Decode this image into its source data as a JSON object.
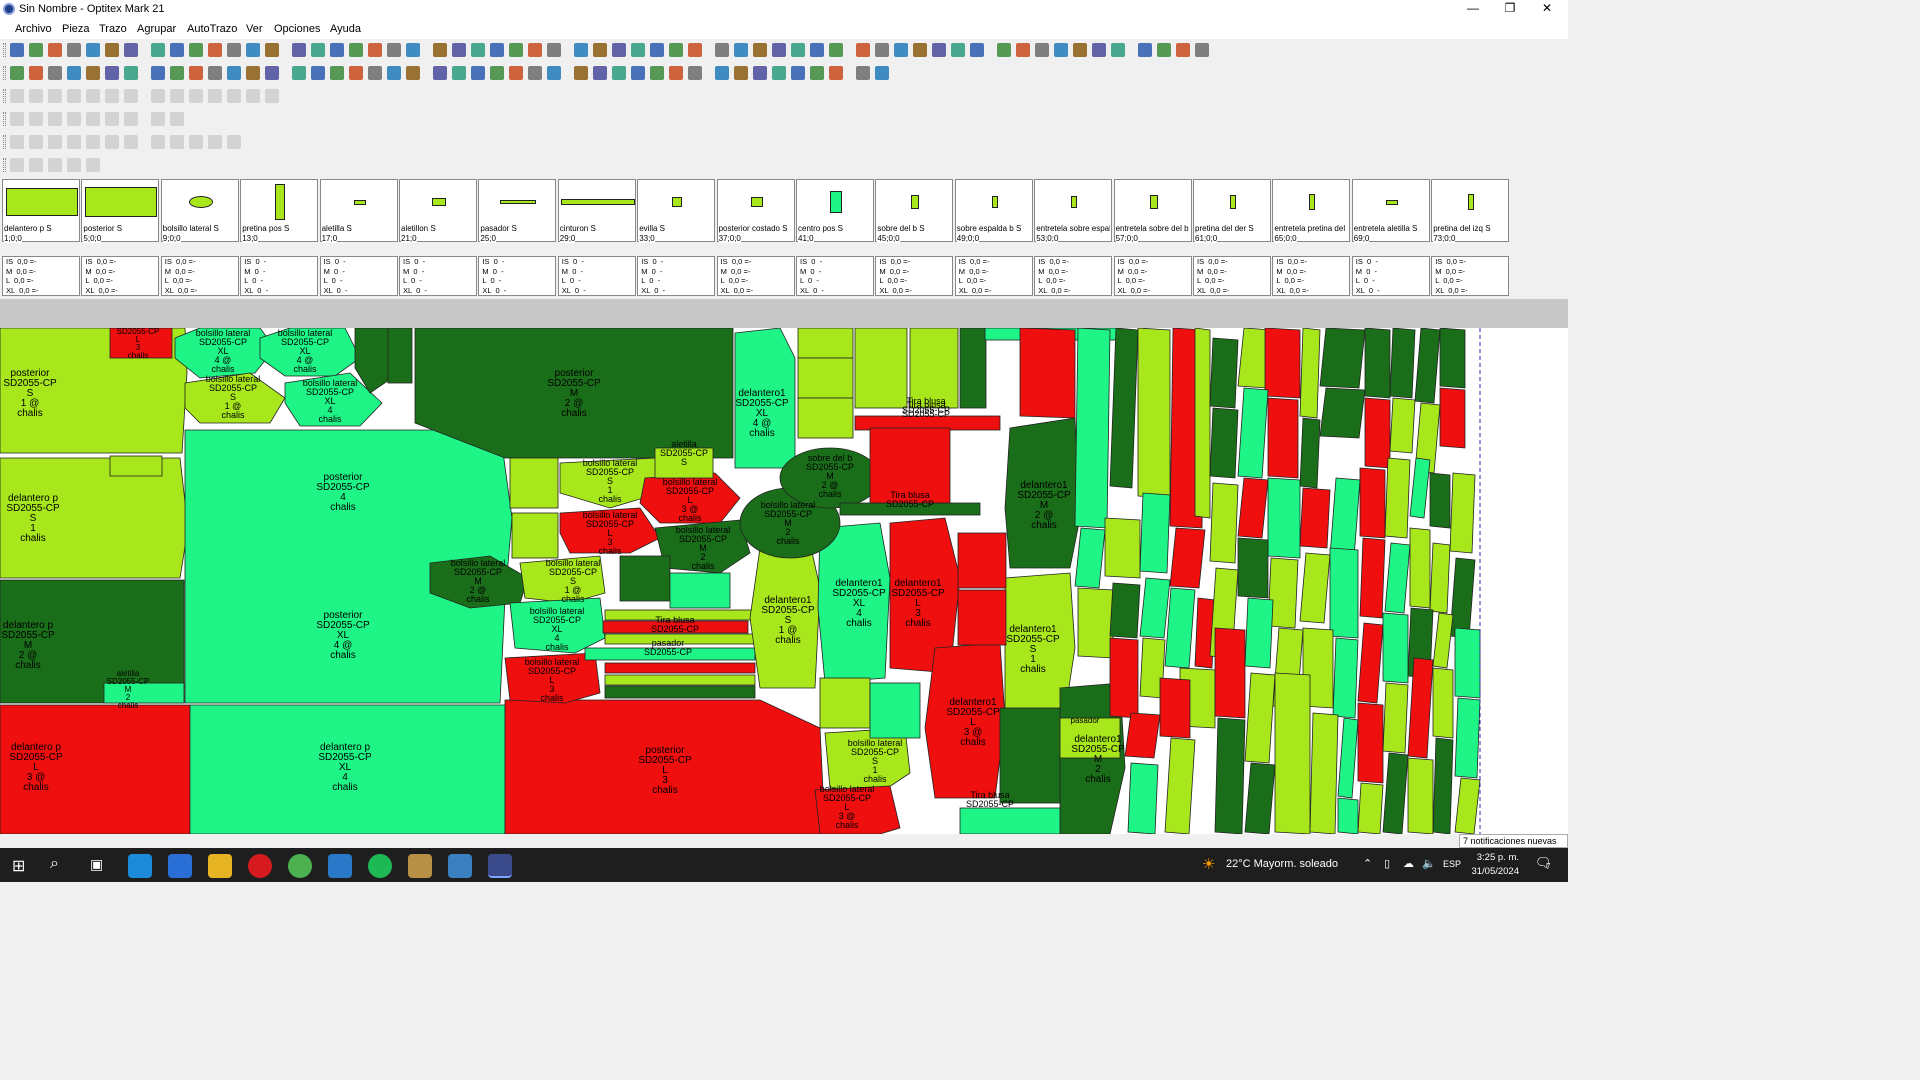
{
  "window": {
    "title": "Sin Nombre - Optitex Mark 21",
    "minimize": "—",
    "maximize": "❐",
    "close": "✕"
  },
  "menu": [
    "Archivo",
    "Pieza",
    "Trazo",
    "Agrupar",
    "AutoTrazo",
    "Ver",
    "Opciones",
    "Ayuda"
  ],
  "pieces": [
    {
      "name": "delantero p S",
      "num": "1;0;0"
    },
    {
      "name": "posterior S",
      "num": "5;0;0"
    },
    {
      "name": "bolsillo lateral S",
      "num": "9;0;0"
    },
    {
      "name": "pretina pos S",
      "num": "13;0"
    },
    {
      "name": "aletilla S",
      "num": "17;0"
    },
    {
      "name": "aletillon S",
      "num": "21;0"
    },
    {
      "name": "pasador S",
      "num": "25;0"
    },
    {
      "name": "cinturon S",
      "num": "29;0"
    },
    {
      "name": "evilla S",
      "num": "33;0"
    },
    {
      "name": "posterior costado S",
      "num": "37;0;0"
    },
    {
      "name": "centro pos S",
      "num": "41;0"
    },
    {
      "name": "sobre del b S",
      "num": "45;0;0"
    },
    {
      "name": "sobre espalda b S",
      "num": "49;0;0"
    },
    {
      "name": "entretela sobre espald",
      "num": "53;0;0"
    },
    {
      "name": "entretela sobre del b S",
      "num": "57;0;0"
    },
    {
      "name": "pretina del der S",
      "num": "61;0;0"
    },
    {
      "name": "entretela pretina del S",
      "num": "65;0;0"
    },
    {
      "name": "entretela aletilla S",
      "num": "69;0"
    },
    {
      "name": "pretina del izq S",
      "num": "73;0;0"
    }
  ],
  "sizes_a": "IS  0,0 =-\nM  0,0 =-\nL  0,0 =-\nXL  0,0 =-",
  "sizes_b": "IS  0  -\nM  0  -\nL  0  -\nXL  0  -",
  "canvas_labels": {
    "posterior": "posterior",
    "sd": "SD2055-CP",
    "delantero_p": "delantero p",
    "delantero1": "delantero1",
    "bolsillo": "bolsillo lateral",
    "aletilla": "aletilla",
    "tira": "Tira blusa",
    "pasador": "pasador",
    "chalis": "chalis"
  },
  "notification": "7 notificaciones nuevas",
  "taskbar": {
    "weather": "22°C  Mayorm. soleado",
    "lang": "ESP",
    "time": "3:25 p. m.",
    "date": "31/05/2024",
    "notif_count": "7"
  },
  "colors": {
    "light_green": "#a7e71c",
    "mint": "#1ef586",
    "dark_green": "#1a6e1a",
    "red": "#ef0f0f"
  }
}
